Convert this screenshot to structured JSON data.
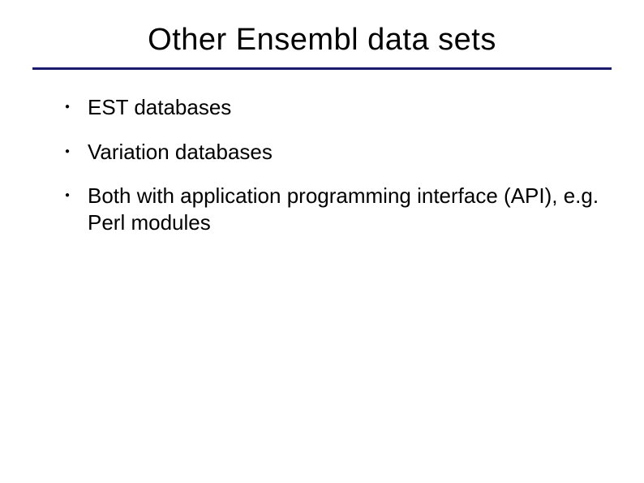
{
  "title": "Other Ensembl data sets",
  "bullets": [
    "EST databases",
    "Variation databases",
    "Both with application programming interface (API), e.g. Perl modules"
  ]
}
